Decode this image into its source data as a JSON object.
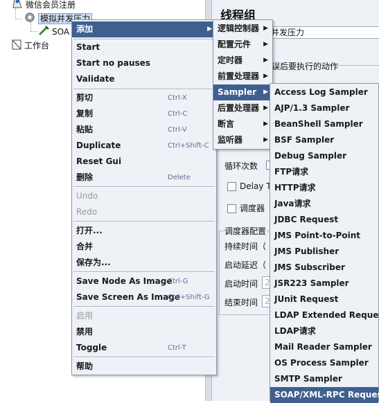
{
  "tree": {
    "items": [
      {
        "label": "微信会员注册"
      },
      {
        "label": "模拟并发压力"
      },
      {
        "label": "SOA"
      },
      {
        "label": "工作台"
      }
    ]
  },
  "panel": {
    "title": "线程组",
    "name_value": "并发压力",
    "error_action_label": "误后要执行的动作",
    "loop_label": "循环次数",
    "delay_label": "Delay Th",
    "scheduler_label": "调度器",
    "scheduler_config_label": "调度器配置",
    "duration_label": "持续时间（",
    "startup_delay_label": "启动延迟（",
    "start_time_label": "启动时间",
    "end_time_label": "结束时间",
    "start_time_hint": "2",
    "end_time_hint": "2"
  },
  "context_menu": {
    "items": [
      {
        "label": "添加"
      },
      {
        "label": "Start"
      },
      {
        "label": "Start no pauses"
      },
      {
        "label": "Validate"
      },
      {
        "label": "剪切",
        "shortcut": "Ctrl-X"
      },
      {
        "label": "复制",
        "shortcut": "Ctrl-C"
      },
      {
        "label": "粘贴",
        "shortcut": "Ctrl-V"
      },
      {
        "label": "Duplicate",
        "shortcut": "Ctrl+Shift-C"
      },
      {
        "label": "Reset Gui"
      },
      {
        "label": "删除",
        "shortcut": "Delete"
      },
      {
        "label": "Undo"
      },
      {
        "label": "Redo"
      },
      {
        "label": "打开..."
      },
      {
        "label": "合并"
      },
      {
        "label": "保存为..."
      },
      {
        "label": "Save Node As Image",
        "shortcut": "Ctrl-G"
      },
      {
        "label": "Save Screen As Image",
        "shortcut": "Ctrl+Shift-G"
      },
      {
        "label": "启用"
      },
      {
        "label": "禁用"
      },
      {
        "label": "Toggle",
        "shortcut": "Ctrl-T"
      },
      {
        "label": "帮助"
      }
    ]
  },
  "add_submenu": {
    "items": [
      {
        "label": "逻辑控制器"
      },
      {
        "label": "配置元件"
      },
      {
        "label": "定时器"
      },
      {
        "label": "前置处理器"
      },
      {
        "label": "Sampler"
      },
      {
        "label": "后置处理器"
      },
      {
        "label": "断言"
      },
      {
        "label": "监听器"
      }
    ]
  },
  "sampler_submenu": {
    "items": [
      {
        "label": "Access Log Sampler"
      },
      {
        "label": "AJP/1.3 Sampler"
      },
      {
        "label": "BeanShell Sampler"
      },
      {
        "label": "BSF Sampler"
      },
      {
        "label": "Debug Sampler"
      },
      {
        "label": "FTP请求"
      },
      {
        "label": "HTTP请求"
      },
      {
        "label": "Java请求"
      },
      {
        "label": "JDBC Request"
      },
      {
        "label": "JMS Point-to-Point"
      },
      {
        "label": "JMS Publisher"
      },
      {
        "label": "JMS Subscriber"
      },
      {
        "label": "JSR223 Sampler"
      },
      {
        "label": "JUnit Request"
      },
      {
        "label": "LDAP Extended Request"
      },
      {
        "label": "LDAP请求"
      },
      {
        "label": "Mail Reader Sampler"
      },
      {
        "label": "OS Process Sampler"
      },
      {
        "label": "SMTP Sampler"
      },
      {
        "label": "SOAP/XML-RPC Request"
      }
    ]
  }
}
